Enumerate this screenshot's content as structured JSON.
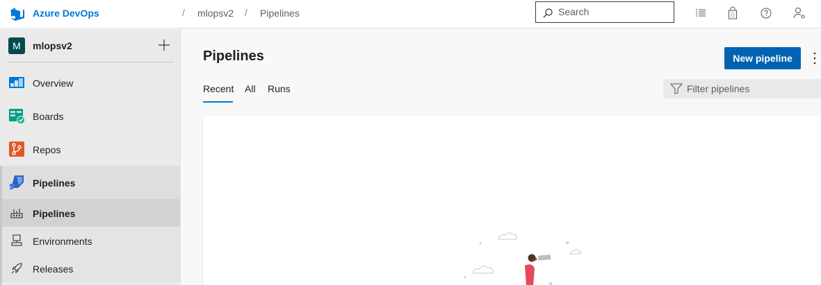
{
  "app": {
    "brand": "Azure DevOps",
    "breadcrumb": [
      "mlopsv2",
      "Pipelines"
    ],
    "search_placeholder": "Search",
    "top_icons": [
      "list-settings-icon",
      "marketplace-bag-icon",
      "help-icon",
      "user-settings-icon"
    ]
  },
  "sidebar": {
    "project_initial": "M",
    "project_name": "mlopsv2",
    "items": [
      {
        "label": "Overview",
        "icon": "overview-icon"
      },
      {
        "label": "Boards",
        "icon": "boards-icon"
      },
      {
        "label": "Repos",
        "icon": "repos-icon"
      },
      {
        "label": "Pipelines",
        "icon": "pipelines-icon"
      }
    ],
    "sub_items": [
      {
        "label": "Pipelines",
        "icon": "pipelines-sub-icon",
        "active": true
      },
      {
        "label": "Environments",
        "icon": "environments-icon"
      },
      {
        "label": "Releases",
        "icon": "releases-icon"
      }
    ]
  },
  "main": {
    "title": "Pipelines",
    "new_button": "New pipeline",
    "tabs": [
      "Recent",
      "All",
      "Runs"
    ],
    "active_tab": "Recent",
    "filter_placeholder": "Filter pipelines"
  },
  "colors": {
    "accent": "#0078d4",
    "primary_button": "#0063b1"
  }
}
